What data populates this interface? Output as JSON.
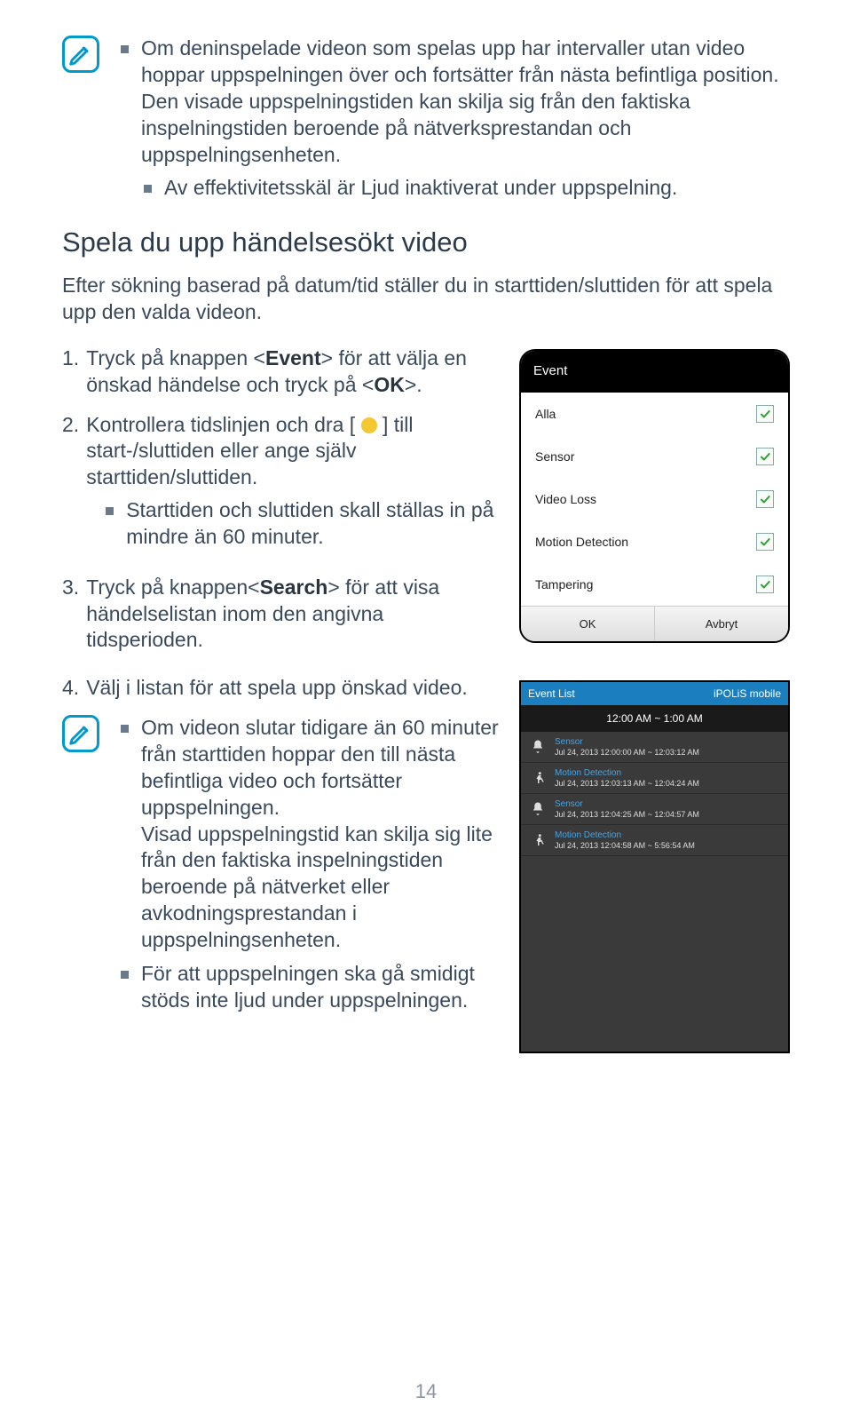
{
  "top_notes": [
    "Om deninspelade videon som spelas upp har intervaller utan video hoppar uppspelningen över och fortsätter från nästa befintliga position. Den visade uppspelningstiden kan skilja sig från den faktiska inspelningstiden beroende på nätverksprestandan och uppspelningsenheten.",
    "Av effektivitetsskäl är Ljud inaktiverat under uppspelning."
  ],
  "heading": "Spela du upp händelsesökt video",
  "intro": "Efter sökning baserad på datum/tid ställer du in starttiden/sluttiden för att spela upp den valda videon.",
  "steps": {
    "s1a": "Tryck på knappen <",
    "s1b": "Event",
    "s1c": "> för att välja en önskad händelse och tryck på <",
    "s1d": "OK",
    "s1e": ">.",
    "s2a": "Kontrollera tidslinjen och dra [ ",
    "s2b": " ] till start-/sluttiden eller ange själv starttiden/sluttiden.",
    "s2sub": "Starttiden och sluttiden skall ställas in på mindre än 60 minuter.",
    "s3a": "Tryck på knappen<",
    "s3b": "Search",
    "s3c": "> för att visa händelselistan inom den angivna tidsperioden.",
    "s4": "Välj i listan för att spela upp önskad video."
  },
  "event_panel": {
    "title": "Event",
    "rows": [
      "Alla",
      "Sensor",
      "Video Loss",
      "Motion Detection",
      "Tampering"
    ],
    "ok": "OK",
    "cancel": "Avbryt"
  },
  "list_panel": {
    "title": "Event List",
    "brand": "iPOLiS mobile",
    "time_range": "12:00 AM ~ 1:00 AM",
    "rows": [
      {
        "type": "Sensor",
        "time": "Jul 24, 2013 12:00:00 AM ~ 12:03:12 AM",
        "icon": "bell"
      },
      {
        "type": "Motion Detection",
        "time": "Jul 24, 2013 12:03:13 AM ~ 12:04:24 AM",
        "icon": "motion"
      },
      {
        "type": "Sensor",
        "time": "Jul 24, 2013 12:04:25 AM ~ 12:04:57 AM",
        "icon": "bell"
      },
      {
        "type": "Motion Detection",
        "time": "Jul 24, 2013 12:04:58 AM ~ 5:56:54 AM",
        "icon": "motion"
      }
    ]
  },
  "bottom_notes": [
    "Om videon slutar tidigare än 60 minuter från starttiden hoppar den till nästa befintliga video och fortsätter uppspelningen.\nVisad uppspelningstid kan skilja sig lite från den faktiska inspelningstiden beroende på nätverket eller avkodningsprestandan i uppspelningsenheten.",
    "För att uppspelningen ska gå smidigt stöds inte ljud under uppspelningen."
  ],
  "page_number": "14"
}
